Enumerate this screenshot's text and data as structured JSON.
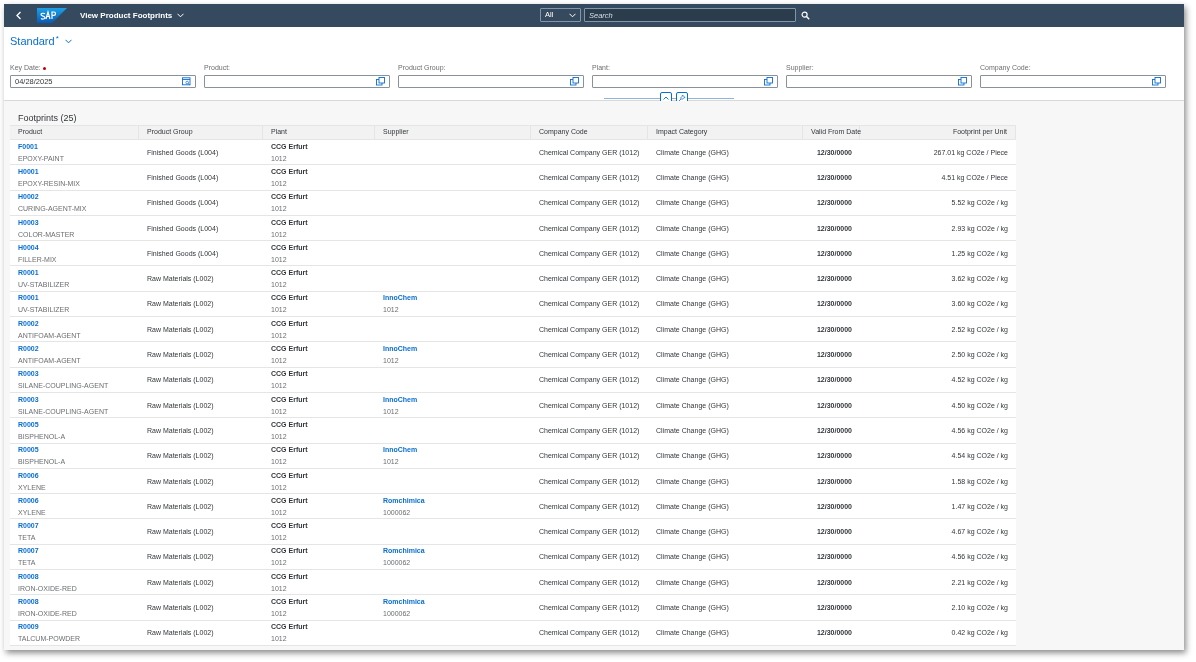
{
  "shell": {
    "title": "View Product Footprints",
    "scope": "All",
    "search_placeholder": "Search"
  },
  "variant": {
    "name": "Standard",
    "modified_mark": "*"
  },
  "filters": [
    {
      "label": "Key Date:",
      "required": true,
      "value": "04/28/2025",
      "kind": "date"
    },
    {
      "label": "Product:",
      "required": false,
      "kind": "valuehelp"
    },
    {
      "label": "Product Group:",
      "required": false,
      "kind": "valuehelp"
    },
    {
      "label": "Plant:",
      "required": false,
      "kind": "valuehelp"
    },
    {
      "label": "Supplier:",
      "required": false,
      "kind": "valuehelp"
    },
    {
      "label": "Company Code:",
      "required": false,
      "kind": "valuehelp"
    }
  ],
  "table": {
    "title": "Footprints (25)",
    "columns": [
      "Product",
      "Product Group",
      "Plant",
      "Supplier",
      "Company Code",
      "Impact Category",
      "Valid From Date",
      "Footprint per Unit"
    ],
    "rows": [
      {
        "product": "F0001",
        "product_name": "EPOXY-PAINT",
        "group": "Finished Goods (L004)",
        "plant": "CCG Erfurt",
        "plant_id": "1012",
        "company": "Chemical Company GER (1012)",
        "category": "Climate Change (GHG)",
        "valid_from": "12/30/0000",
        "footprint": "267.01 kg CO2e / Piece"
      },
      {
        "product": "H0001",
        "product_name": "EPOXY-RESIN-MIX",
        "group": "Finished Goods (L004)",
        "plant": "CCG Erfurt",
        "plant_id": "1012",
        "company": "Chemical Company GER (1012)",
        "category": "Climate Change (GHG)",
        "valid_from": "12/30/0000",
        "footprint": "4.51 kg CO2e / Piece"
      },
      {
        "product": "H0002",
        "product_name": "CURING-AGENT-MIX",
        "group": "Finished Goods (L004)",
        "plant": "CCG Erfurt",
        "plant_id": "1012",
        "company": "Chemical Company GER (1012)",
        "category": "Climate Change (GHG)",
        "valid_from": "12/30/0000",
        "footprint": "5.52 kg CO2e / kg"
      },
      {
        "product": "H0003",
        "product_name": "COLOR-MASTER",
        "group": "Finished Goods (L004)",
        "plant": "CCG Erfurt",
        "plant_id": "1012",
        "company": "Chemical Company GER (1012)",
        "category": "Climate Change (GHG)",
        "valid_from": "12/30/0000",
        "footprint": "2.93 kg CO2e / kg"
      },
      {
        "product": "H0004",
        "product_name": "FILLER-MIX",
        "group": "Finished Goods (L004)",
        "plant": "CCG Erfurt",
        "plant_id": "1012",
        "company": "Chemical Company GER (1012)",
        "category": "Climate Change (GHG)",
        "valid_from": "12/30/0000",
        "footprint": "1.25 kg CO2e / kg"
      },
      {
        "product": "R0001",
        "product_name": "UV-STABILIZER",
        "group": "Raw Materials (L002)",
        "plant": "CCG Erfurt",
        "plant_id": "1012",
        "company": "Chemical Company GER (1012)",
        "category": "Climate Change (GHG)",
        "valid_from": "12/30/0000",
        "footprint": "3.62 kg CO2e / kg"
      },
      {
        "product": "R0001",
        "product_name": "UV-STABILIZER",
        "group": "Raw Materials (L002)",
        "plant": "CCG Erfurt",
        "plant_id": "1012",
        "supplier": "InnoChem",
        "supplier_id": "1012",
        "company": "Chemical Company GER (1012)",
        "category": "Climate Change (GHG)",
        "valid_from": "12/30/0000",
        "footprint": "3.60 kg CO2e / kg"
      },
      {
        "product": "R0002",
        "product_name": "ANTIFOAM-AGENT",
        "group": "Raw Materials (L002)",
        "plant": "CCG Erfurt",
        "plant_id": "1012",
        "company": "Chemical Company GER (1012)",
        "category": "Climate Change (GHG)",
        "valid_from": "12/30/0000",
        "footprint": "2.52 kg CO2e / kg"
      },
      {
        "product": "R0002",
        "product_name": "ANTIFOAM-AGENT",
        "group": "Raw Materials (L002)",
        "plant": "CCG Erfurt",
        "plant_id": "1012",
        "supplier": "InnoChem",
        "supplier_id": "1012",
        "company": "Chemical Company GER (1012)",
        "category": "Climate Change (GHG)",
        "valid_from": "12/30/0000",
        "footprint": "2.50 kg CO2e / kg"
      },
      {
        "product": "R0003",
        "product_name": "SILANE-COUPLING-AGENT",
        "group": "Raw Materials (L002)",
        "plant": "CCG Erfurt",
        "plant_id": "1012",
        "company": "Chemical Company GER (1012)",
        "category": "Climate Change (GHG)",
        "valid_from": "12/30/0000",
        "footprint": "4.52 kg CO2e / kg"
      },
      {
        "product": "R0003",
        "product_name": "SILANE-COUPLING-AGENT",
        "group": "Raw Materials (L002)",
        "plant": "CCG Erfurt",
        "plant_id": "1012",
        "supplier": "InnoChem",
        "supplier_id": "1012",
        "company": "Chemical Company GER (1012)",
        "category": "Climate Change (GHG)",
        "valid_from": "12/30/0000",
        "footprint": "4.50 kg CO2e / kg"
      },
      {
        "product": "R0005",
        "product_name": "BISPHENOL-A",
        "group": "Raw Materials (L002)",
        "plant": "CCG Erfurt",
        "plant_id": "1012",
        "company": "Chemical Company GER (1012)",
        "category": "Climate Change (GHG)",
        "valid_from": "12/30/0000",
        "footprint": "4.56 kg CO2e / kg"
      },
      {
        "product": "R0005",
        "product_name": "BISPHENOL-A",
        "group": "Raw Materials (L002)",
        "plant": "CCG Erfurt",
        "plant_id": "1012",
        "supplier": "InnoChem",
        "supplier_id": "1012",
        "company": "Chemical Company GER (1012)",
        "category": "Climate Change (GHG)",
        "valid_from": "12/30/0000",
        "footprint": "4.54 kg CO2e / kg"
      },
      {
        "product": "R0006",
        "product_name": "XYLENE",
        "group": "Raw Materials (L002)",
        "plant": "CCG Erfurt",
        "plant_id": "1012",
        "company": "Chemical Company GER (1012)",
        "category": "Climate Change (GHG)",
        "valid_from": "12/30/0000",
        "footprint": "1.58 kg CO2e / kg"
      },
      {
        "product": "R0006",
        "product_name": "XYLENE",
        "group": "Raw Materials (L002)",
        "plant": "CCG Erfurt",
        "plant_id": "1012",
        "supplier": "Romchimica",
        "supplier_id": "1000062",
        "company": "Chemical Company GER (1012)",
        "category": "Climate Change (GHG)",
        "valid_from": "12/30/0000",
        "footprint": "1.47 kg CO2e / kg"
      },
      {
        "product": "R0007",
        "product_name": "TETA",
        "group": "Raw Materials (L002)",
        "plant": "CCG Erfurt",
        "plant_id": "1012",
        "company": "Chemical Company GER (1012)",
        "category": "Climate Change (GHG)",
        "valid_from": "12/30/0000",
        "footprint": "4.67 kg CO2e / kg"
      },
      {
        "product": "R0007",
        "product_name": "TETA",
        "group": "Raw Materials (L002)",
        "plant": "CCG Erfurt",
        "plant_id": "1012",
        "supplier": "Romchimica",
        "supplier_id": "1000062",
        "company": "Chemical Company GER (1012)",
        "category": "Climate Change (GHG)",
        "valid_from": "12/30/0000",
        "footprint": "4.56 kg CO2e / kg"
      },
      {
        "product": "R0008",
        "product_name": "IRON-OXIDE-RED",
        "group": "Raw Materials (L002)",
        "plant": "CCG Erfurt",
        "plant_id": "1012",
        "company": "Chemical Company GER (1012)",
        "category": "Climate Change (GHG)",
        "valid_from": "12/30/0000",
        "footprint": "2.21 kg CO2e / kg"
      },
      {
        "product": "R0008",
        "product_name": "IRON-OXIDE-RED",
        "group": "Raw Materials (L002)",
        "plant": "CCG Erfurt",
        "plant_id": "1012",
        "supplier": "Romchimica",
        "supplier_id": "1000062",
        "company": "Chemical Company GER (1012)",
        "category": "Climate Change (GHG)",
        "valid_from": "12/30/0000",
        "footprint": "2.10 kg CO2e / kg"
      },
      {
        "product": "R0009",
        "product_name": "TALCUM-POWDER",
        "group": "Raw Materials (L002)",
        "plant": "CCG Erfurt",
        "plant_id": "1012",
        "company": "Chemical Company GER (1012)",
        "category": "Climate Change (GHG)",
        "valid_from": "12/30/0000",
        "footprint": "0.42 kg CO2e / kg"
      }
    ]
  }
}
